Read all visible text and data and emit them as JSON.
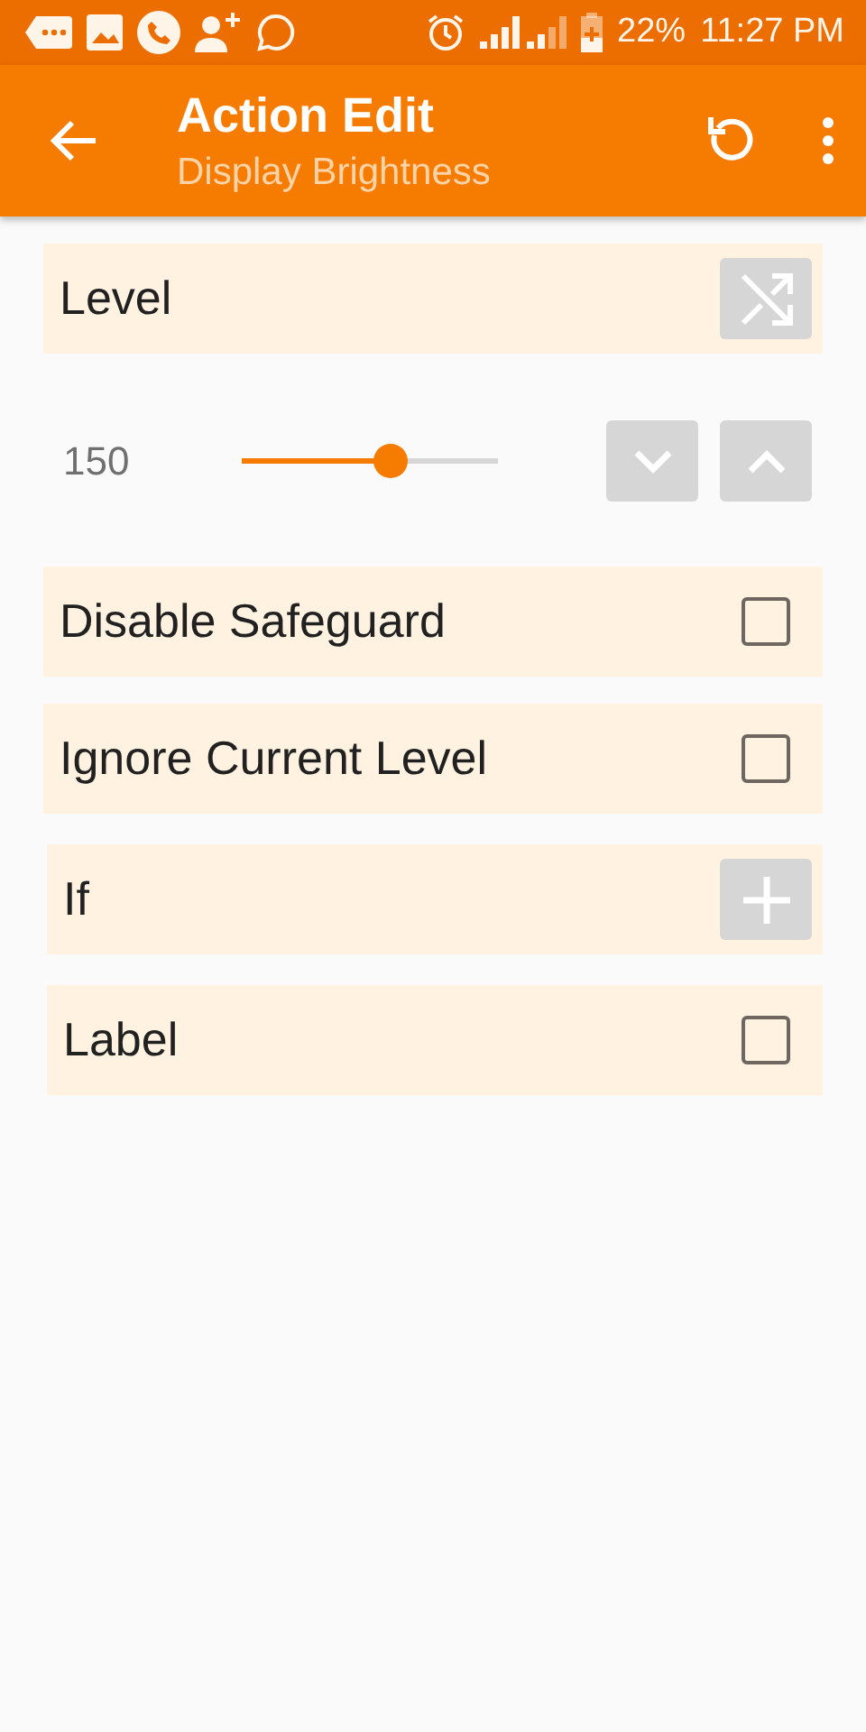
{
  "status_bar": {
    "battery": "22%",
    "time": "11:27 PM"
  },
  "app_bar": {
    "title": "Action Edit",
    "subtitle": "Display Brightness"
  },
  "sections": [
    {
      "kind": "header",
      "label": "Level"
    },
    {
      "kind": "slider",
      "reading": "150",
      "level": 0.58
    },
    {
      "kind": "checkbox",
      "label": "Disable Safeguard",
      "checked": false
    },
    {
      "kind": "checkbox",
      "label": "Ignore Current Level",
      "checked": false
    },
    {
      "kind": "add",
      "label": "If"
    },
    {
      "kind": "checkbox",
      "label": "Label",
      "checked": false
    }
  ]
}
